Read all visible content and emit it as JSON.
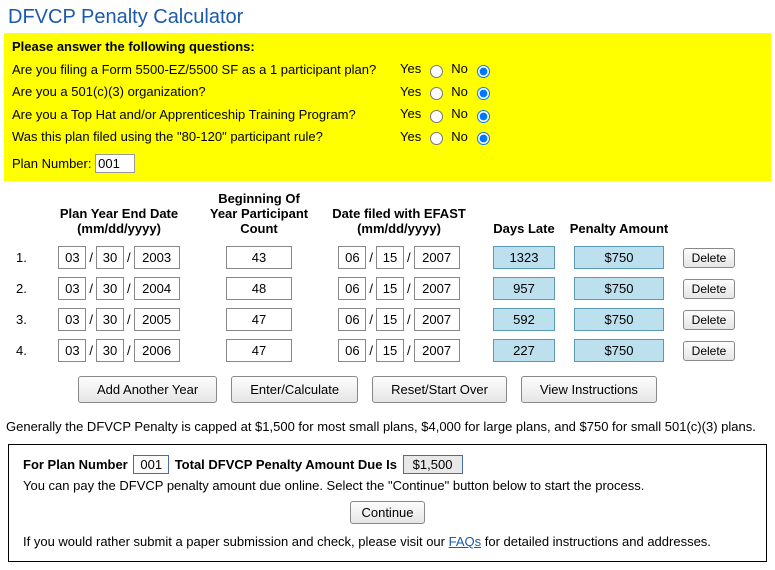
{
  "title": "DFVCP Penalty Calculator",
  "questions": {
    "header": "Please answer the following questions:",
    "yes": "Yes",
    "no": "No",
    "items": [
      {
        "text": "Are you filing a Form 5500-EZ/5500 SF as a 1 participant plan?",
        "answer": "no"
      },
      {
        "text": "Are you a 501(c)(3) organization?",
        "answer": "no"
      },
      {
        "text": "Are you a Top Hat and/or Apprenticeship Training Program?",
        "answer": "no"
      },
      {
        "text": "Was this plan filed using the \"80-120\" participant rule?",
        "answer": "no"
      }
    ],
    "plan_number_label": "Plan Number:",
    "plan_number": "001"
  },
  "table": {
    "headers": {
      "end_date": "Plan Year End Date (mm/dd/yyyy)",
      "count": "Beginning Of Year Participant Count",
      "filed": "Date filed with EFAST (mm/dd/yyyy)",
      "days": "Days Late",
      "penalty": "Penalty Amount"
    },
    "rows": [
      {
        "idx": "1.",
        "end_mm": "03",
        "end_dd": "30",
        "end_yyyy": "2003",
        "count": "43",
        "filed_mm": "06",
        "filed_dd": "15",
        "filed_yyyy": "2007",
        "days": "1323",
        "penalty": "$750"
      },
      {
        "idx": "2.",
        "end_mm": "03",
        "end_dd": "30",
        "end_yyyy": "2004",
        "count": "48",
        "filed_mm": "06",
        "filed_dd": "15",
        "filed_yyyy": "2007",
        "days": "957",
        "penalty": "$750"
      },
      {
        "idx": "3.",
        "end_mm": "03",
        "end_dd": "30",
        "end_yyyy": "2005",
        "count": "47",
        "filed_mm": "06",
        "filed_dd": "15",
        "filed_yyyy": "2007",
        "days": "592",
        "penalty": "$750"
      },
      {
        "idx": "4.",
        "end_mm": "03",
        "end_dd": "30",
        "end_yyyy": "2006",
        "count": "47",
        "filed_mm": "06",
        "filed_dd": "15",
        "filed_yyyy": "2007",
        "days": "227",
        "penalty": "$750"
      }
    ],
    "delete_label": "Delete"
  },
  "buttons": {
    "add": "Add Another Year",
    "calc": "Enter/Calculate",
    "reset": "Reset/Start Over",
    "instructions": "View Instructions"
  },
  "cap_note": "Generally the DFVCP Penalty is capped at $1,500 for most small plans, $4,000 for large plans, and $750 for small 501(c)(3) plans.",
  "summary": {
    "for_plan": "For Plan Number",
    "plan_number": "001",
    "total_label": "Total DFVCP Penalty Amount Due Is",
    "total": "$1,500",
    "pay_text": "You can pay the DFVCP penalty amount due online. Select the \"Continue\" button below to start the process.",
    "continue": "Continue",
    "paper_pre": "If you would rather submit a paper submission and check, please visit our ",
    "faqs": "FAQs",
    "paper_post": " for detailed instructions and addresses."
  }
}
